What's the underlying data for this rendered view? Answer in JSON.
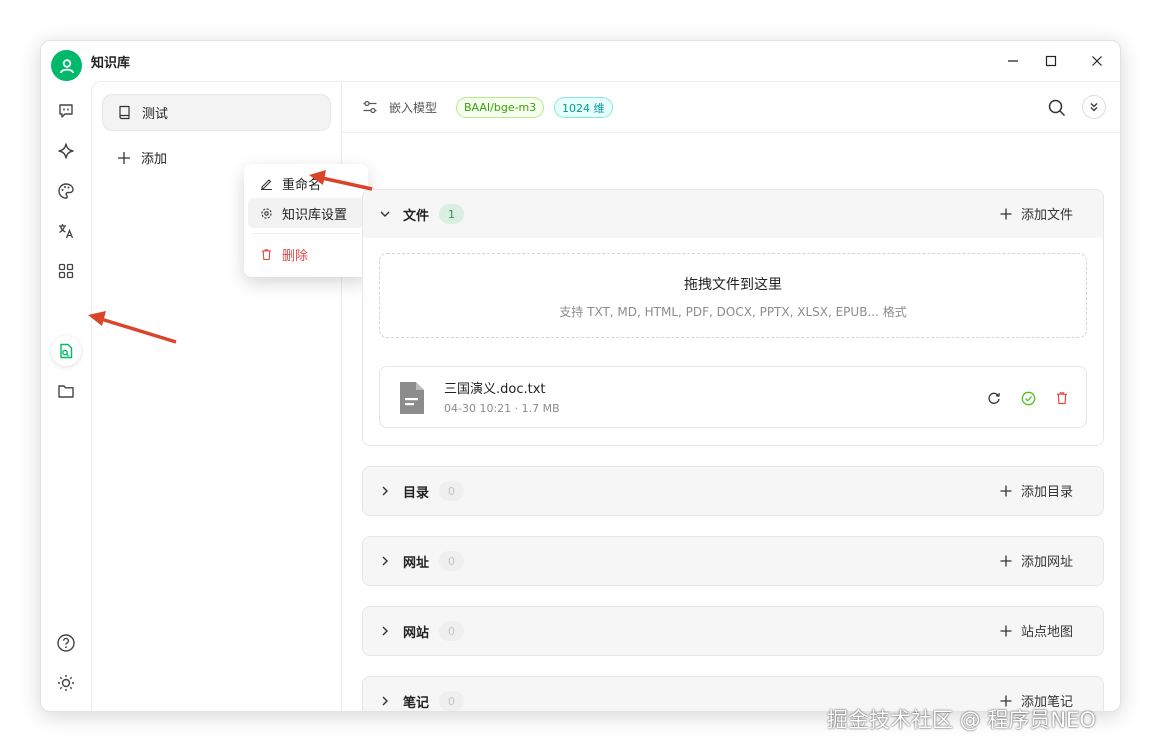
{
  "app": {
    "title": "知识库"
  },
  "knowledge_base": {
    "item_name": "测试",
    "add_label": "添加"
  },
  "context_menu": {
    "rename": "重命名",
    "settings": "知识库设置",
    "delete": "删除"
  },
  "topbar": {
    "embed_label": "嵌入模型",
    "model_tag": "BAAI/bge-m3",
    "dim_tag": "1024 维"
  },
  "sections": {
    "files": {
      "title": "文件",
      "count": "1",
      "action": "添加文件"
    },
    "directories": {
      "title": "目录",
      "count": "0",
      "action": "添加目录"
    },
    "urls": {
      "title": "网址",
      "count": "0",
      "action": "添加网址"
    },
    "sites": {
      "title": "网站",
      "count": "0",
      "action": "站点地图"
    },
    "notes": {
      "title": "笔记",
      "count": "0",
      "action": "添加笔记"
    }
  },
  "dropzone": {
    "title": "拖拽文件到这里",
    "subtitle": "支持 TXT, MD, HTML, PDF, DOCX, PPTX, XLSX, EPUB... 格式"
  },
  "file": {
    "name": "三国演义.doc.txt",
    "meta": "04-30 10:21 · 1.7 MB"
  },
  "watermark": "掘金技术社区 @ 程序员NEO",
  "colors": {
    "accent": "#00b96b",
    "annotation_arrow": "#d9442b",
    "danger": "#e04848"
  },
  "icons": {
    "rail": [
      "chat-icon",
      "sparkle-icon",
      "palette-icon",
      "translate-icon",
      "apps-icon",
      "knowledge-icon",
      "folder-icon",
      "help-icon",
      "sun-icon",
      "settings-icon"
    ]
  }
}
